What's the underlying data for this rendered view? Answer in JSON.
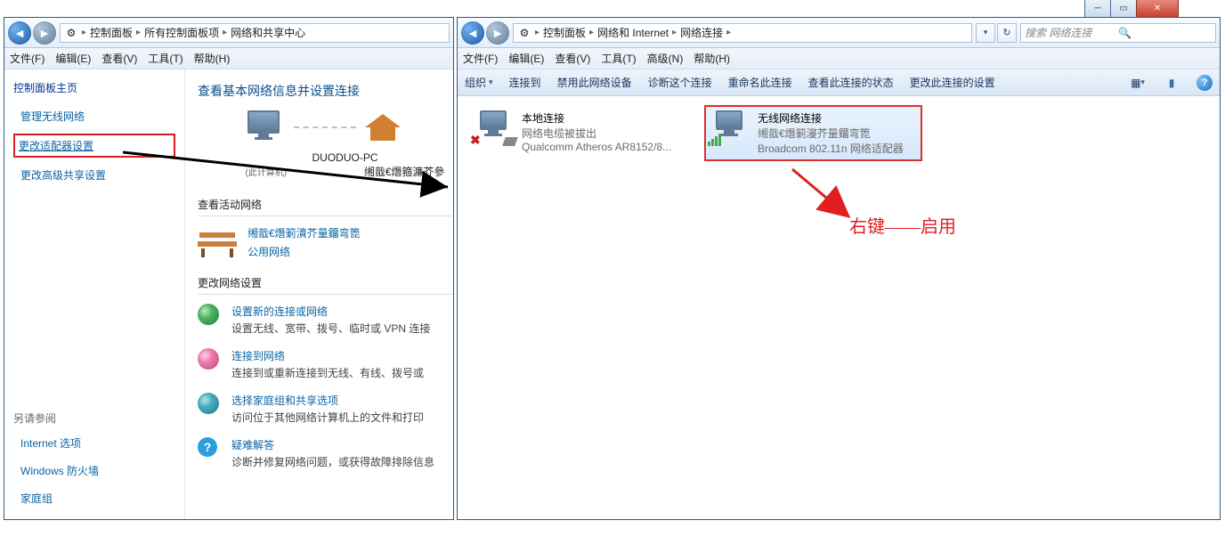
{
  "left": {
    "breadcrumb": [
      "控制面板",
      "所有控制面板项",
      "网络和共享中心"
    ],
    "menus": [
      "文件(F)",
      "编辑(E)",
      "查看(V)",
      "工具(T)",
      "帮助(H)"
    ],
    "sidebar": {
      "home": "控制面板主页",
      "links": [
        "管理无线网络",
        "更改适配器设置",
        "更改高级共享设置"
      ],
      "seealso_title": "另请参阅",
      "seealso": [
        "Internet 选项",
        "Windows 防火墙",
        "家庭组"
      ]
    },
    "main": {
      "title": "查看基本网络信息并设置连接",
      "pc_name": "DUODUO-PC",
      "pc_sub": "(此计算机)",
      "net_name": "缃戠€熸箍濂芥參",
      "active_title": "查看活动网络",
      "active_name": "缃戠€熸箣濆芥量鐂弯箆",
      "active_type": "公用网络",
      "settings_title": "更改网络设置",
      "items": [
        {
          "link": "设置新的连接或网络",
          "desc": "设置无线、宽带、拨号、临时或 VPN 连接"
        },
        {
          "link": "连接到网络",
          "desc": "连接到或重新连接到无线、有线、拨号或"
        },
        {
          "link": "选择家庭组和共享选项",
          "desc": "访问位于其他网络计算机上的文件和打印"
        },
        {
          "link": "疑难解答",
          "desc": "诊断并修复网络问题，或获得故障排除信息"
        }
      ]
    }
  },
  "right": {
    "breadcrumb": [
      "控制面板",
      "网络和 Internet",
      "网络连接"
    ],
    "search_placeholder": "搜索 网络连接",
    "menus": [
      "文件(F)",
      "编辑(E)",
      "查看(V)",
      "工具(T)",
      "高级(N)",
      "帮助(H)"
    ],
    "toolbar": [
      "组织",
      "连接到",
      "禁用此网络设备",
      "诊断这个连接",
      "重命名此连接",
      "查看此连接的状态",
      "更改此连接的设置"
    ],
    "connections": [
      {
        "name": "本地连接",
        "status": "网络电缆被拔出",
        "device": "Qualcomm Atheros AR8152/8...",
        "disabled": true
      },
      {
        "name": "无线网络连接",
        "status": "缃戠€熸箣濅芥量鐂弯箆",
        "device": "Broadcom 802.11n 网络适配器",
        "selected": true
      }
    ],
    "annotation": "右键——启用"
  }
}
